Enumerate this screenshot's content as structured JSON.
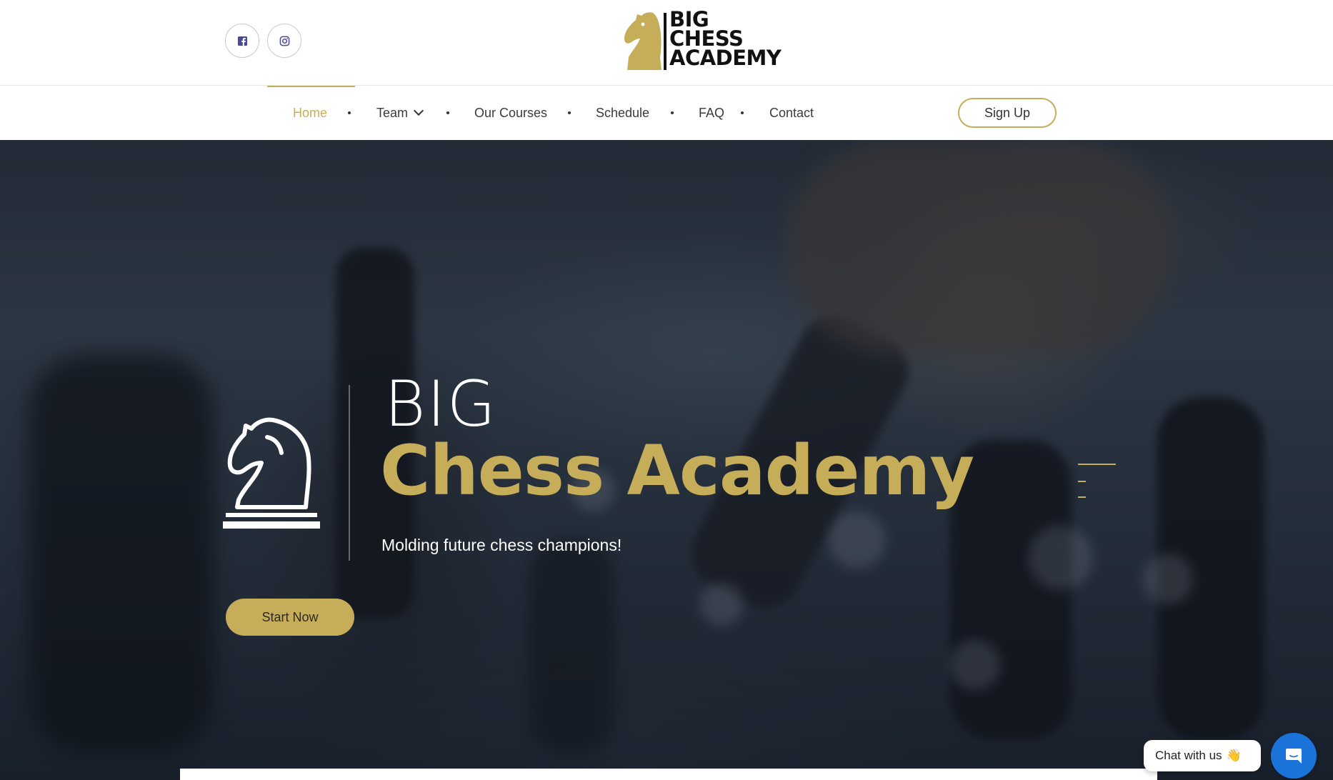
{
  "header": {
    "social": [
      {
        "icon": "facebook-icon"
      },
      {
        "icon": "instagram-icon"
      }
    ],
    "logo": {
      "line1": "BIG",
      "line2": "CHESS",
      "line3": "ACADEMY"
    }
  },
  "nav": {
    "items": [
      {
        "label": "Home",
        "active": true
      },
      {
        "label": "Team",
        "has_dropdown": true
      },
      {
        "label": "Our Courses"
      },
      {
        "label": "Schedule"
      },
      {
        "label": "FAQ"
      },
      {
        "label": "Contact"
      }
    ],
    "signup_label": "Sign Up"
  },
  "hero": {
    "title_small": "BIG",
    "title_large": "Chess Academy",
    "subtitle": "Molding future chess champions!",
    "cta_label": "Start Now",
    "slide_count": 3,
    "active_slide": 1
  },
  "chat": {
    "label": "Chat with us",
    "emoji": "👋",
    "icon": "chat-bubble-icon"
  },
  "colors": {
    "accent": "#c5ad5a",
    "text_dark": "#3b3b3b",
    "chat_blue": "#1a73d9"
  }
}
